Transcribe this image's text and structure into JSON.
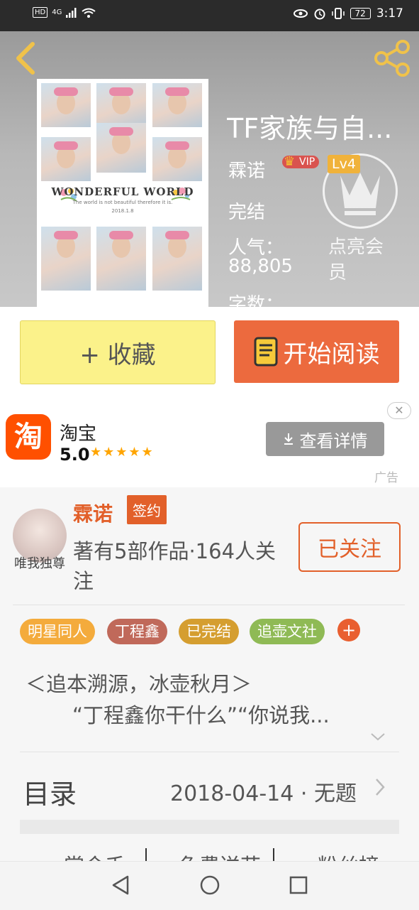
{
  "status_bar": {
    "network": "HD",
    "signal_type": "4G",
    "battery": "72",
    "time": "3:17"
  },
  "book": {
    "title": "TF家族与自...",
    "author": "霖诺",
    "vip": "VIP",
    "level": "Lv4",
    "status": "完结",
    "popularity_label": "人气：",
    "popularity_value": "88,805",
    "word_count_label": "字数：",
    "light_member": "点亮会员",
    "cover": {
      "title": "WONDERFUL WORLD",
      "subtitle": "The world is not beautiful therefore it is.",
      "date": "2018.1.8"
    }
  },
  "actions": {
    "collect": "+ 收藏",
    "read": "开始阅读"
  },
  "ad": {
    "app_icon_text": "淘",
    "app_name": "淘宝",
    "rating": "5.0",
    "stars": "★★★★★",
    "button": "查看详情",
    "label": "广告"
  },
  "author": {
    "avatar_caption": "唯我独尊",
    "name": "霖诺",
    "badge": "签约",
    "works": "著有5部作品·164人关注",
    "follow": "已关注"
  },
  "tags": [
    {
      "label": "明星同人",
      "color": "#f4ab3c"
    },
    {
      "label": "丁程鑫",
      "color": "#c0695a"
    },
    {
      "label": "已完结",
      "color": "#d59e30"
    },
    {
      "label": "追壶文社",
      "color": "#8fba55"
    }
  ],
  "tag_add": "+",
  "intro": {
    "line1": "＜追本溯源，冰壶秋月＞",
    "line2": "“丁程鑫你干什么”“你说我...",
    "expand_icon": "chevron-down-icon"
  },
  "catalog": {
    "label": "目录",
    "latest": "2018-04-14 · 无题"
  },
  "bottom_tabs": [
    "掌令千",
    "免费送花",
    "粉丝榜"
  ],
  "colors": {
    "accent": "#e2602a",
    "read_button": "#ec6a3e",
    "collect_button": "#fbf28a",
    "back_icon": "#f0c24a"
  }
}
